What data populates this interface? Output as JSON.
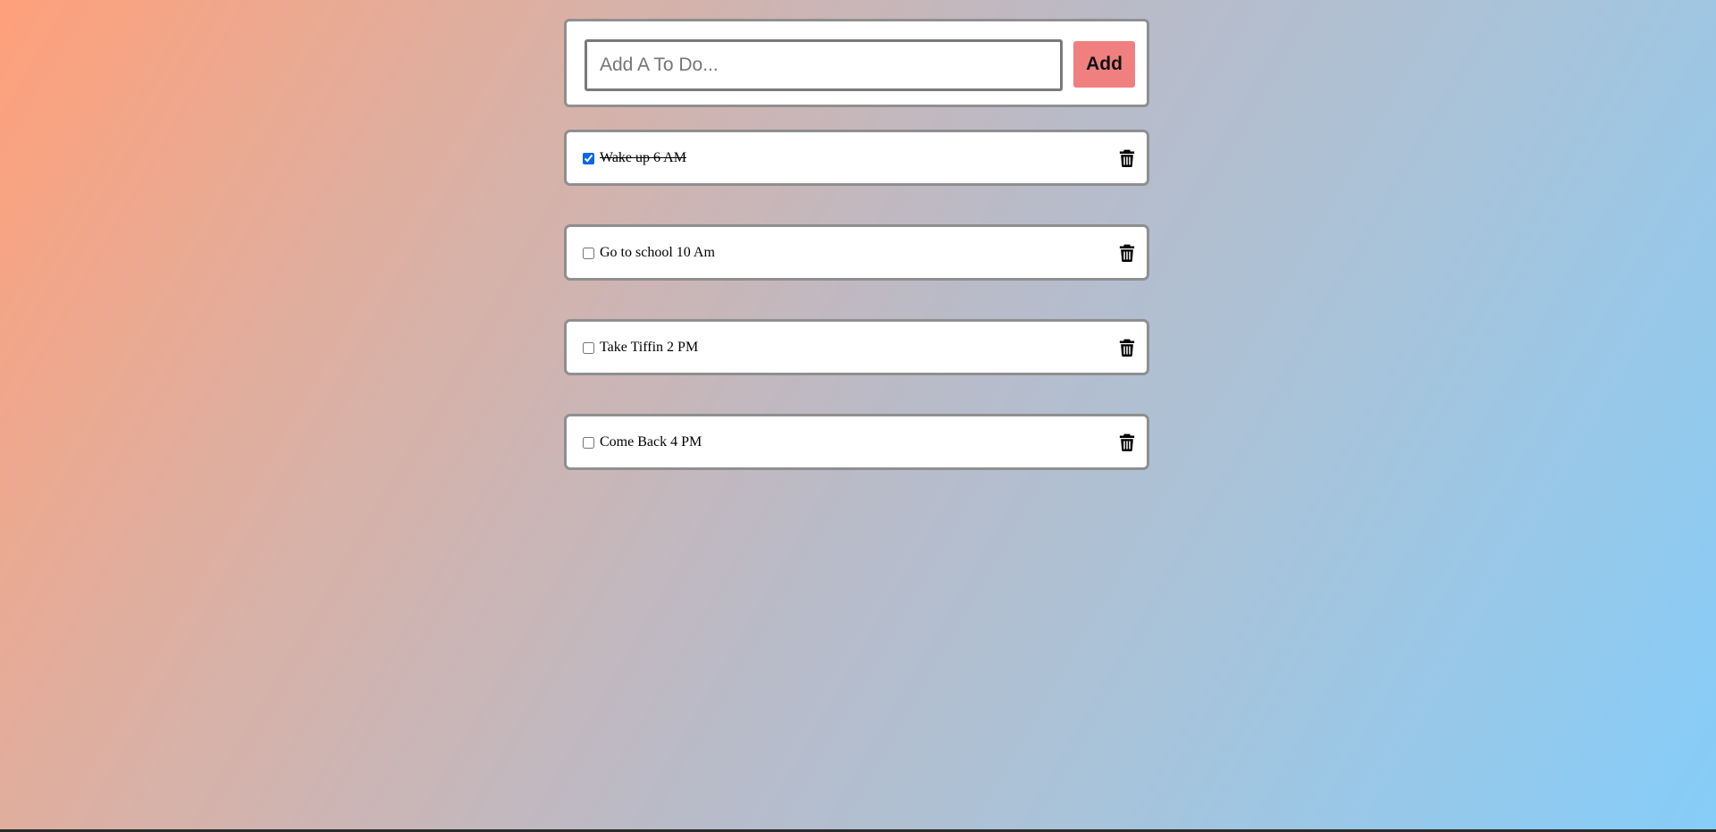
{
  "new_todo": {
    "placeholder": "Add A To Do...",
    "value": "",
    "add_label": "Add"
  },
  "todos": [
    {
      "text": "Wake up 6 AM",
      "done": true,
      "delete_icon": "trash-icon"
    },
    {
      "text": "Go to school 10 Am",
      "done": false,
      "delete_icon": "trash-icon"
    },
    {
      "text": "Take Tiffin 2 PM",
      "done": false,
      "delete_icon": "trash-icon"
    },
    {
      "text": "Come Back 4 PM",
      "done": false,
      "delete_icon": "trash-icon"
    }
  ],
  "colors": {
    "add_button": "#f08080",
    "checkbox_accent": "#0a66e8",
    "gradient_start": "#ffa07a",
    "gradient_end": "#85cdf9"
  }
}
